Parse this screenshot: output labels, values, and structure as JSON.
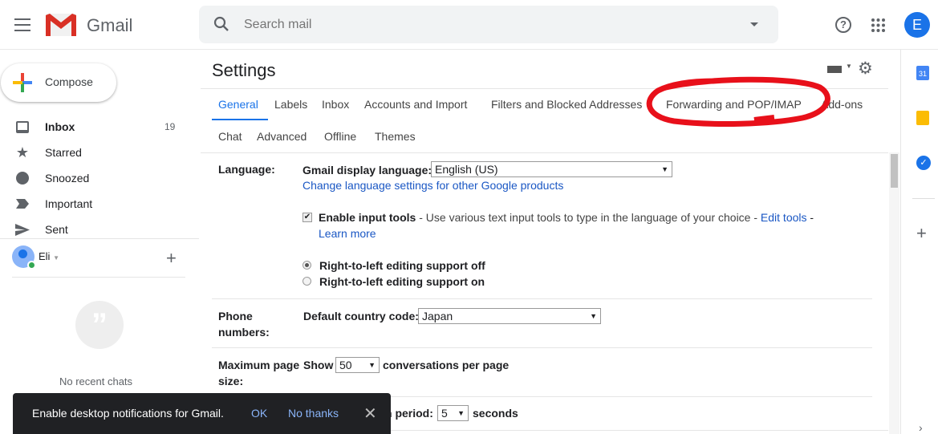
{
  "header": {
    "app_name": "Gmail",
    "search_placeholder": "Search mail",
    "avatar_letter": "E"
  },
  "sidebar": {
    "compose": "Compose",
    "items": [
      {
        "label": "Inbox",
        "count": "19",
        "icon": "inbox-icon"
      },
      {
        "label": "Starred",
        "icon": "star-icon"
      },
      {
        "label": "Snoozed",
        "icon": "clock-icon"
      },
      {
        "label": "Important",
        "icon": "label-important-icon"
      },
      {
        "label": "Sent",
        "icon": "send-icon"
      }
    ],
    "user": "Eli",
    "no_chats": "No recent chats"
  },
  "settings": {
    "title": "Settings",
    "tabs_row1": [
      "General",
      "Labels",
      "Inbox",
      "Accounts and Import",
      "Filters and Blocked Addresses",
      "Forwarding and POP/IMAP",
      "Add-ons"
    ],
    "tabs_row2": [
      "Chat",
      "Advanced",
      "Offline",
      "Themes"
    ],
    "language": {
      "label": "Language:",
      "display_label": "Gmail display language:",
      "display_value": "English (US)",
      "change_link": "Change language settings for other Google products",
      "input_tools_label": "Enable input tools",
      "input_tools_desc": " - Use various text input tools to type in the language of your choice - ",
      "edit_tools": "Edit tools",
      "dash": "-",
      "learn_more": "Learn more",
      "rtl_off": "Right-to-left editing support off",
      "rtl_on": "Right-to-left editing support on"
    },
    "phone": {
      "label1": "Phone",
      "label2": "numbers:",
      "field_label": "Default country code:",
      "value": "Japan"
    },
    "page_size": {
      "label1": "Maximum page",
      "label2": "size:",
      "show": "Show",
      "value": "50",
      "suffix": "conversations per page"
    },
    "undo": {
      "partial_label": "n period:",
      "value": "5",
      "suffix": "seconds"
    }
  },
  "snackbar": {
    "message": "Enable desktop notifications for Gmail.",
    "ok": "OK",
    "no_thanks": "No thanks"
  },
  "annotation_color": "#e8101a",
  "accent": "#1a73e8"
}
